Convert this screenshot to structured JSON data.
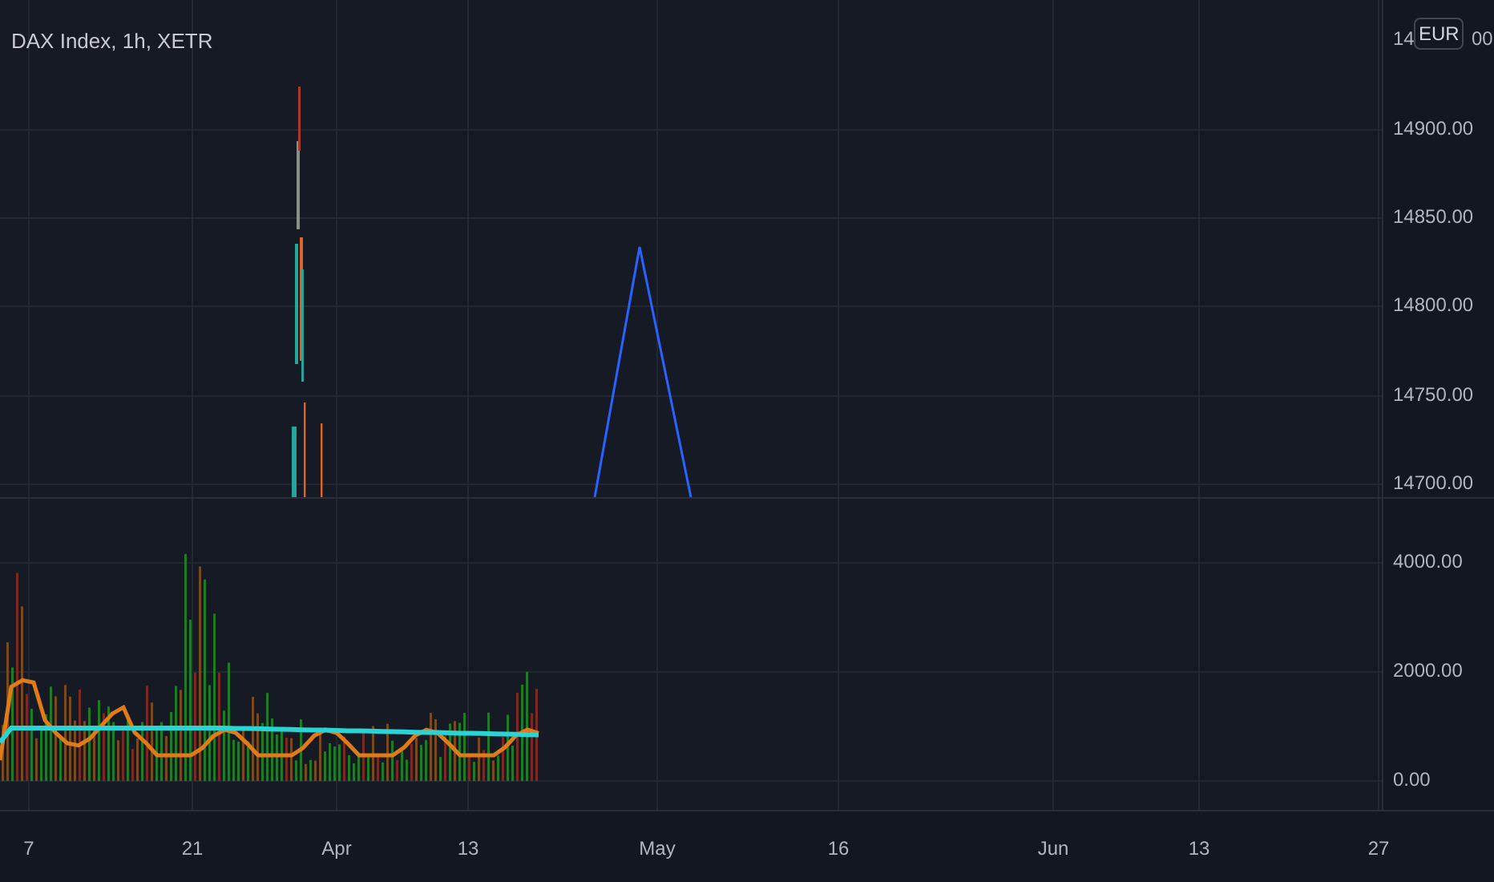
{
  "title": "DAX Index, 1h, XETR",
  "currency_badge": "EUR",
  "price_axis": {
    "covered_label_parts": [
      "14",
      "00"
    ],
    "labels": [
      "14900.00",
      "14850.00",
      "14800.00",
      "14750.00",
      "14700.00"
    ]
  },
  "volume_axis": {
    "labels": [
      "4000.00",
      "2000.00",
      "0.00"
    ]
  },
  "time_axis": {
    "labels": [
      "7",
      "21",
      "Apr",
      "13",
      "May",
      "16",
      "Jun",
      "13",
      "27"
    ]
  }
}
